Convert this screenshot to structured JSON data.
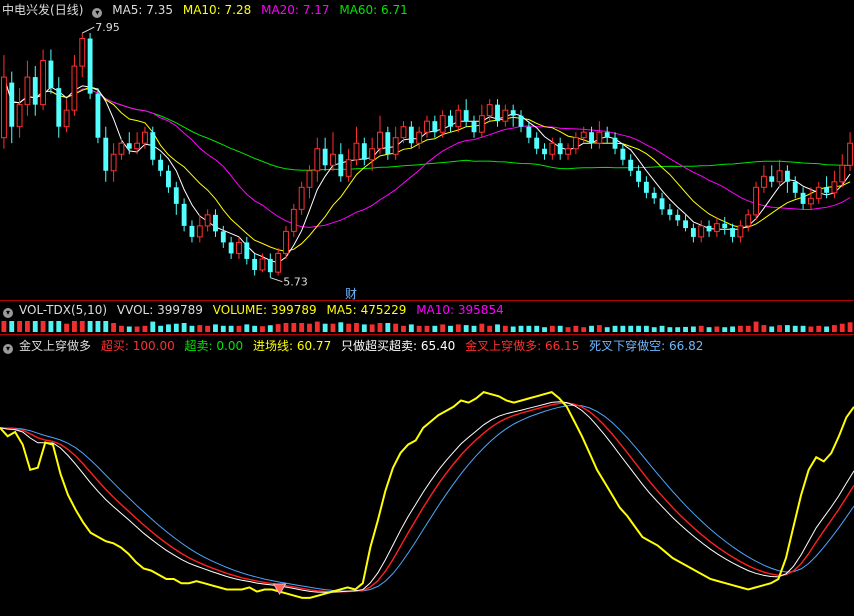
{
  "colors": {
    "background": "#000000",
    "up": "#ff3030",
    "down": "#54ffff",
    "ma5": "#ffffff",
    "ma10": "#ffff00",
    "ma20": "#ff00ff",
    "ma60": "#00e600",
    "divider": "#b00000",
    "yellow_line": "#ffff00",
    "white_line": "#ffffff",
    "red_line": "#ff2020",
    "blue_line": "#4da6ff"
  },
  "price_panel": {
    "stock_name": "中电兴发",
    "period": "(日线)",
    "ma5": {
      "label": "MA5:",
      "value": "7.35"
    },
    "ma10": {
      "label": "MA10:",
      "value": "7.28"
    },
    "ma20": {
      "label": "MA20:",
      "value": "7.17"
    },
    "ma60": {
      "label": "MA60:",
      "value": "6.71"
    },
    "high_marker": "7.95",
    "low_marker": "5.73",
    "event_marker": "财"
  },
  "volume_panel": {
    "indicator": "VOL-TDX(5,10)",
    "vvol": {
      "label": "VVOL:",
      "value": "399789"
    },
    "volume": {
      "label": "VOLUME:",
      "value": "399789"
    },
    "ma5": {
      "label": "MA5:",
      "value": "475229"
    },
    "ma10": {
      "label": "MA10:",
      "value": "395854"
    }
  },
  "indicator_panel": {
    "name": "金叉上穿做多",
    "overbought": {
      "label": "超买:",
      "value": "100.00"
    },
    "oversold": {
      "label": "超卖:",
      "value": "0.00"
    },
    "entry_line": {
      "label": "进场线:",
      "value": "60.77"
    },
    "only_overbought_oversold": {
      "label": "只做超买超卖:",
      "value": "65.40"
    },
    "golden_cross": {
      "label": "金叉上穿做多:",
      "value": "66.15"
    },
    "death_cross": {
      "label": "死叉下穿做空:",
      "value": "66.82"
    }
  },
  "chart_data": {
    "type": "candlestick",
    "price_range": [
      5.6,
      8.05
    ],
    "candles": [
      [
        7.0,
        7.55,
        7.75,
        6.9
      ],
      [
        7.5,
        7.1,
        7.6,
        6.95
      ],
      [
        7.1,
        7.3,
        7.45,
        7.0
      ],
      [
        7.3,
        7.55,
        7.7,
        7.2
      ],
      [
        7.55,
        7.3,
        7.65,
        7.2
      ],
      [
        7.3,
        7.7,
        7.8,
        7.25
      ],
      [
        7.7,
        7.45,
        7.8,
        7.4
      ],
      [
        7.45,
        7.1,
        7.55,
        7.0
      ],
      [
        7.1,
        7.25,
        7.35,
        7.05
      ],
      [
        7.25,
        7.65,
        7.75,
        7.2
      ],
      [
        7.65,
        7.9,
        7.95,
        7.55
      ],
      [
        7.9,
        7.4,
        7.95,
        7.35
      ],
      [
        7.4,
        7.0,
        7.45,
        6.95
      ],
      [
        7.0,
        6.7,
        7.1,
        6.6
      ],
      [
        6.7,
        6.85,
        6.95,
        6.6
      ],
      [
        6.85,
        6.95,
        7.0,
        6.8
      ],
      [
        6.95,
        6.9,
        7.05,
        6.85
      ],
      [
        6.9,
        6.95,
        7.05,
        6.85
      ],
      [
        6.95,
        7.05,
        7.1,
        6.9
      ],
      [
        7.05,
        6.8,
        7.1,
        6.75
      ],
      [
        6.8,
        6.7,
        6.85,
        6.65
      ],
      [
        6.7,
        6.55,
        6.75,
        6.5
      ],
      [
        6.55,
        6.4,
        6.6,
        6.3
      ],
      [
        6.4,
        6.2,
        6.45,
        6.15
      ],
      [
        6.2,
        6.1,
        6.25,
        6.05
      ],
      [
        6.1,
        6.2,
        6.3,
        6.05
      ],
      [
        6.2,
        6.3,
        6.35,
        6.15
      ],
      [
        6.3,
        6.15,
        6.35,
        6.1
      ],
      [
        6.15,
        6.05,
        6.2,
        6.0
      ],
      [
        6.05,
        5.95,
        6.1,
        5.9
      ],
      [
        5.95,
        6.05,
        6.1,
        5.9
      ],
      [
        6.05,
        5.9,
        6.1,
        5.85
      ],
      [
        5.9,
        5.8,
        5.95,
        5.75
      ],
      [
        5.8,
        5.9,
        5.95,
        5.78
      ],
      [
        5.9,
        5.78,
        5.95,
        5.73
      ],
      [
        5.78,
        5.95,
        6.0,
        5.75
      ],
      [
        5.95,
        6.15,
        6.2,
        5.9
      ],
      [
        6.15,
        6.35,
        6.4,
        6.1
      ],
      [
        6.35,
        6.55,
        6.6,
        6.3
      ],
      [
        6.55,
        6.7,
        6.75,
        6.45
      ],
      [
        6.7,
        6.9,
        7.0,
        6.6
      ],
      [
        6.9,
        6.75,
        7.0,
        6.7
      ],
      [
        6.75,
        6.85,
        7.05,
        6.7
      ],
      [
        6.85,
        6.65,
        6.95,
        6.6
      ],
      [
        6.65,
        6.8,
        6.9,
        6.6
      ],
      [
        6.8,
        6.95,
        7.1,
        6.75
      ],
      [
        6.95,
        6.8,
        7.0,
        6.75
      ],
      [
        6.8,
        6.9,
        7.0,
        6.7
      ],
      [
        6.9,
        7.05,
        7.2,
        6.85
      ],
      [
        7.05,
        6.85,
        7.1,
        6.8
      ],
      [
        6.85,
        7.0,
        7.1,
        6.8
      ],
      [
        7.0,
        7.1,
        7.15,
        6.95
      ],
      [
        7.1,
        6.95,
        7.15,
        6.9
      ],
      [
        6.95,
        7.05,
        7.1,
        6.9
      ],
      [
        7.05,
        7.15,
        7.2,
        7.0
      ],
      [
        7.15,
        7.05,
        7.2,
        7.0
      ],
      [
        7.05,
        7.2,
        7.25,
        7.0
      ],
      [
        7.2,
        7.1,
        7.25,
        7.05
      ],
      [
        7.1,
        7.25,
        7.3,
        7.05
      ],
      [
        7.25,
        7.15,
        7.35,
        7.1
      ],
      [
        7.15,
        7.05,
        7.2,
        7.0
      ],
      [
        7.05,
        7.2,
        7.3,
        7.0
      ],
      [
        7.2,
        7.3,
        7.35,
        7.15
      ],
      [
        7.3,
        7.15,
        7.35,
        7.1
      ],
      [
        7.15,
        7.25,
        7.3,
        7.1
      ],
      [
        7.25,
        7.2,
        7.3,
        7.1
      ],
      [
        7.2,
        7.1,
        7.25,
        7.05
      ],
      [
        7.1,
        7.0,
        7.15,
        6.95
      ],
      [
        7.0,
        6.9,
        7.05,
        6.85
      ],
      [
        6.9,
        6.85,
        6.95,
        6.8
      ],
      [
        6.85,
        6.95,
        7.0,
        6.8
      ],
      [
        6.95,
        6.85,
        7.0,
        6.8
      ],
      [
        6.85,
        6.9,
        6.95,
        6.8
      ],
      [
        6.9,
        7.0,
        7.05,
        6.85
      ],
      [
        7.0,
        7.05,
        7.1,
        6.95
      ],
      [
        7.05,
        6.95,
        7.1,
        6.9
      ],
      [
        6.95,
        7.05,
        7.15,
        6.9
      ],
      [
        7.05,
        7.0,
        7.1,
        6.95
      ],
      [
        7.0,
        6.9,
        7.05,
        6.85
      ],
      [
        6.9,
        6.8,
        6.95,
        6.75
      ],
      [
        6.8,
        6.7,
        6.85,
        6.65
      ],
      [
        6.7,
        6.6,
        6.75,
        6.55
      ],
      [
        6.6,
        6.5,
        6.65,
        6.45
      ],
      [
        6.5,
        6.45,
        6.55,
        6.4
      ],
      [
        6.45,
        6.35,
        6.5,
        6.3
      ],
      [
        6.35,
        6.3,
        6.4,
        6.25
      ],
      [
        6.3,
        6.25,
        6.35,
        6.2
      ],
      [
        6.25,
        6.18,
        6.3,
        6.15
      ],
      [
        6.18,
        6.1,
        6.22,
        6.05
      ],
      [
        6.1,
        6.2,
        6.25,
        6.05
      ],
      [
        6.2,
        6.15,
        6.25,
        6.1
      ],
      [
        6.15,
        6.22,
        6.28,
        6.1
      ],
      [
        6.22,
        6.18,
        6.28,
        6.12
      ],
      [
        6.18,
        6.1,
        6.22,
        6.05
      ],
      [
        6.1,
        6.2,
        6.25,
        6.05
      ],
      [
        6.2,
        6.3,
        6.35,
        6.15
      ],
      [
        6.3,
        6.55,
        6.6,
        6.25
      ],
      [
        6.55,
        6.65,
        6.75,
        6.5
      ],
      [
        6.65,
        6.6,
        6.75,
        6.55
      ],
      [
        6.6,
        6.7,
        6.8,
        6.55
      ],
      [
        6.7,
        6.6,
        6.75,
        6.5
      ],
      [
        6.6,
        6.5,
        6.65,
        6.45
      ],
      [
        6.5,
        6.4,
        6.55,
        6.35
      ],
      [
        6.4,
        6.45,
        6.55,
        6.35
      ],
      [
        6.45,
        6.55,
        6.6,
        6.4
      ],
      [
        6.55,
        6.5,
        6.65,
        6.45
      ],
      [
        6.5,
        6.6,
        6.7,
        6.45
      ],
      [
        6.6,
        6.75,
        6.85,
        6.55
      ],
      [
        6.75,
        6.95,
        7.05,
        6.7
      ]
    ],
    "ma_periods": {
      "ma5": 5,
      "ma10": 10,
      "ma20": 20,
      "ma60": 60
    },
    "indicator": {
      "range": [
        0,
        100
      ],
      "yellow": [
        82,
        78,
        80,
        74,
        62,
        63,
        75,
        74,
        60,
        50,
        43,
        37,
        32,
        30,
        28,
        27,
        25,
        22,
        18,
        15,
        14,
        12,
        10,
        10,
        8,
        8,
        9,
        8,
        7,
        6,
        5,
        5,
        5,
        6,
        4,
        5,
        5,
        4,
        3,
        2,
        1,
        1,
        2,
        3,
        4,
        5,
        6,
        5,
        8,
        25,
        38,
        52,
        63,
        70,
        74,
        76,
        82,
        85,
        88,
        90,
        92,
        95,
        94,
        96,
        99,
        98,
        97,
        95,
        94,
        95,
        96,
        97,
        98,
        99,
        96,
        92,
        85,
        78,
        70,
        62,
        56,
        50,
        44,
        40,
        35,
        30,
        28,
        26,
        23,
        20,
        18,
        16,
        14,
        12,
        10,
        9,
        8,
        7,
        6,
        5,
        6,
        7,
        8,
        10,
        20,
        35,
        50,
        62,
        68,
        66,
        70,
        78,
        87,
        92
      ]
    }
  }
}
